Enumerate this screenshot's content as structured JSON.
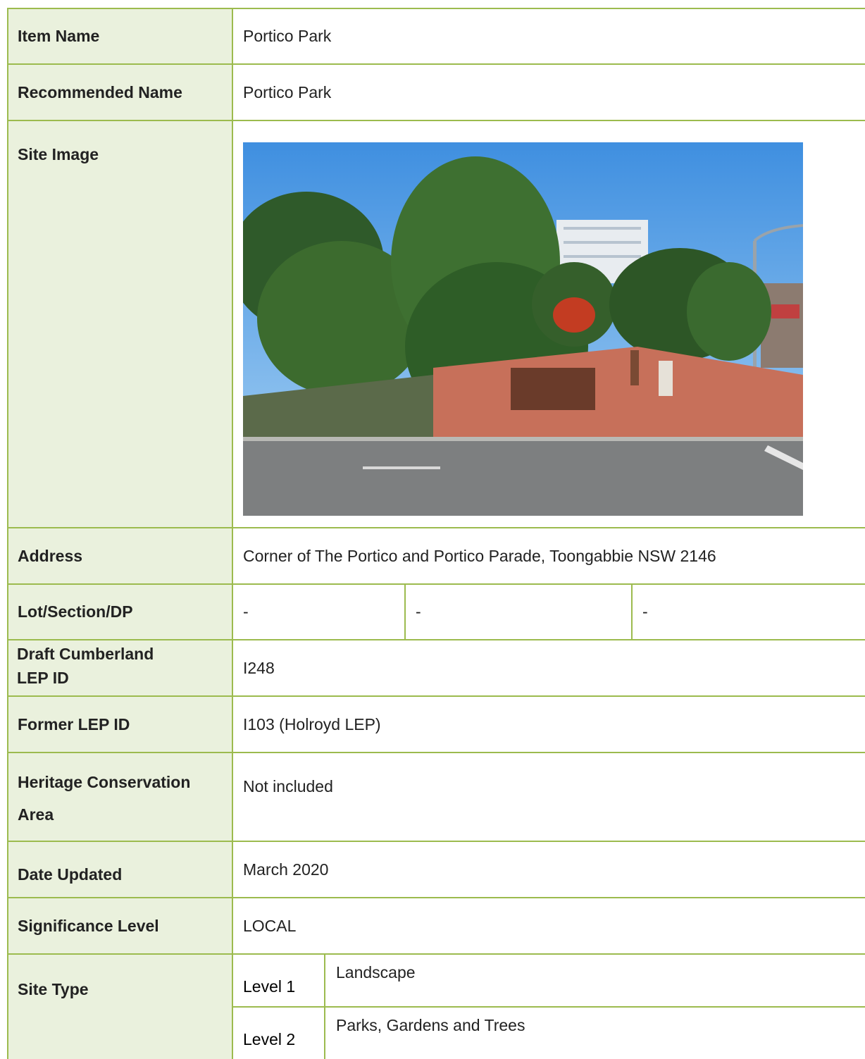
{
  "rows": {
    "item_name": {
      "label": "Item Name",
      "value": "Portico Park"
    },
    "recommended_name": {
      "label": "Recommended Name",
      "value": "Portico Park"
    },
    "site_image": {
      "label": "Site Image"
    },
    "address": {
      "label": "Address",
      "value": "Corner of The Portico and Portico Parade, Toongabbie NSW 2146"
    },
    "lot": {
      "label": "Lot/Section/DP",
      "lot": "-",
      "section": "-",
      "dp": "-"
    },
    "draft_lep": {
      "label_line1": "Draft Cumberland",
      "label_line2": "LEP ID",
      "value": "I248"
    },
    "former_lep": {
      "label": "Former LEP ID",
      "value": "I103 (Holroyd LEP)"
    },
    "hca": {
      "label_line1": "Heritage Conservation",
      "label_line2": "Area",
      "value": "Not included"
    },
    "date_updated": {
      "label": "Date Updated",
      "value": "March 2020"
    },
    "significance": {
      "label": "Significance Level",
      "value": "LOCAL"
    },
    "site_type": {
      "label": "Site Type",
      "level1_label": "Level 1",
      "level1_value": "Landscape",
      "level2_label": "Level 2",
      "level2_value": "Parks, Gardens and Trees"
    }
  },
  "colors": {
    "border": "#9cbb4e",
    "label_bg": "#eaf1dd"
  }
}
